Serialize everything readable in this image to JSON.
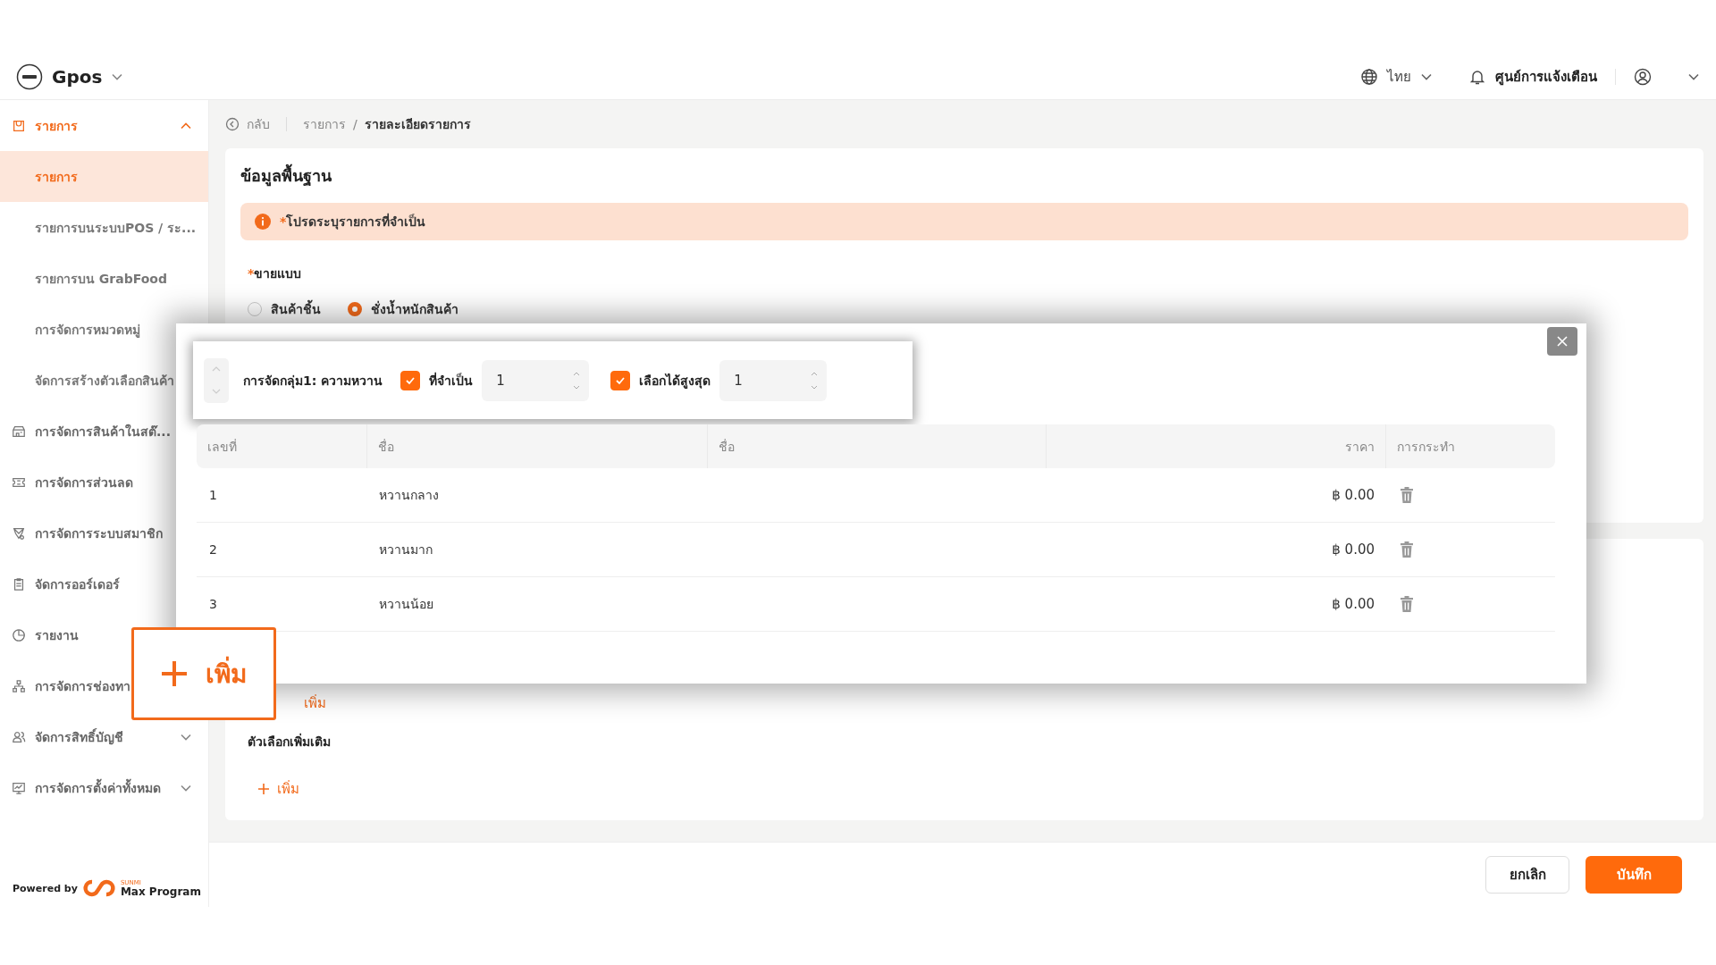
{
  "header": {
    "brand": "Gpos",
    "language": "ไทย",
    "notifications": "ศูนย์การแจ้งเตือน"
  },
  "sidebar": {
    "items": [
      {
        "label": "รายการ",
        "kind": "group",
        "selected": true,
        "expanded": true,
        "children": [
          {
            "label": "รายการ",
            "selected": true
          },
          {
            "label": "รายการบนระบบPOS / ระ...",
            "selected": false
          },
          {
            "label": "รายการบน GrabFood",
            "selected": false
          },
          {
            "label": "การจัดการหมวดหมู่",
            "selected": false
          },
          {
            "label": "จัดการสร้างตัวเลือกสินค้า",
            "selected": false
          }
        ]
      },
      {
        "label": "การจัดการสินค้าในสต๊...",
        "kind": "link",
        "selected": false
      },
      {
        "label": "การจัดการส่วนลด",
        "kind": "link",
        "selected": false
      },
      {
        "label": "การจัดการระบบสมาชิก",
        "kind": "link",
        "selected": false
      },
      {
        "label": "จัดการออร์เดอร์",
        "kind": "link",
        "selected": false
      },
      {
        "label": "รายงาน",
        "kind": "link",
        "selected": false
      },
      {
        "label": "การจัดการช่องทา",
        "kind": "link",
        "selected": false
      },
      {
        "label": "จัดการสิทธิ์บัญชี",
        "kind": "group",
        "selected": false,
        "expanded": false
      },
      {
        "label": "การจัดการตั้งค่าทั้งหมด",
        "kind": "group",
        "selected": false,
        "expanded": false
      }
    ],
    "powered_by": "Powered by",
    "logo_small": "SUNMI",
    "logo_name": "Max Program"
  },
  "breadcrumb": {
    "back": "กลับ",
    "items": [
      "รายการ",
      "รายละเอียดรายการ"
    ],
    "separator": "/"
  },
  "basic_info": {
    "title": "ข้อมูลพื้นฐาน",
    "alert": "โปรดระบุรายการที่จำเป็น",
    "required_mark": "*",
    "sell_by": {
      "label": "ขายแบบ",
      "options": [
        {
          "label": "สินค้าชิ้น",
          "selected": false
        },
        {
          "label": "ชั่งน้ำหนักสินค้า",
          "selected": true
        }
      ]
    }
  },
  "popup": {
    "group_title": "การจัดกลุ่ม1: ความหวาน",
    "required": {
      "label": "ที่จำเป็น",
      "checked": true,
      "value": "1"
    },
    "max_select": {
      "label": "เลือกได้สูงสุด",
      "checked": true,
      "value": "1"
    },
    "columns": [
      "เลขที่",
      "ชื่อ",
      "ชื่อ",
      "ราคา",
      "การกระทำ"
    ],
    "rows": [
      {
        "number": "1",
        "name": "หวานกลาง",
        "price": "฿ 0.00"
      },
      {
        "number": "2",
        "name": "หวานมาก",
        "price": "฿ 0.00"
      },
      {
        "number": "3",
        "name": "หวานน้อย",
        "price": "฿ 0.00"
      }
    ]
  },
  "options_card": {
    "hidden_add": "เพิ่ม",
    "title": "ตัวเลือกเพิ่มเติม",
    "add": "เพิ่ม"
  },
  "callout": {
    "label": "เพิ่ม"
  },
  "footer": {
    "cancel": "ยกเลิก",
    "save": "บันทึก"
  }
}
